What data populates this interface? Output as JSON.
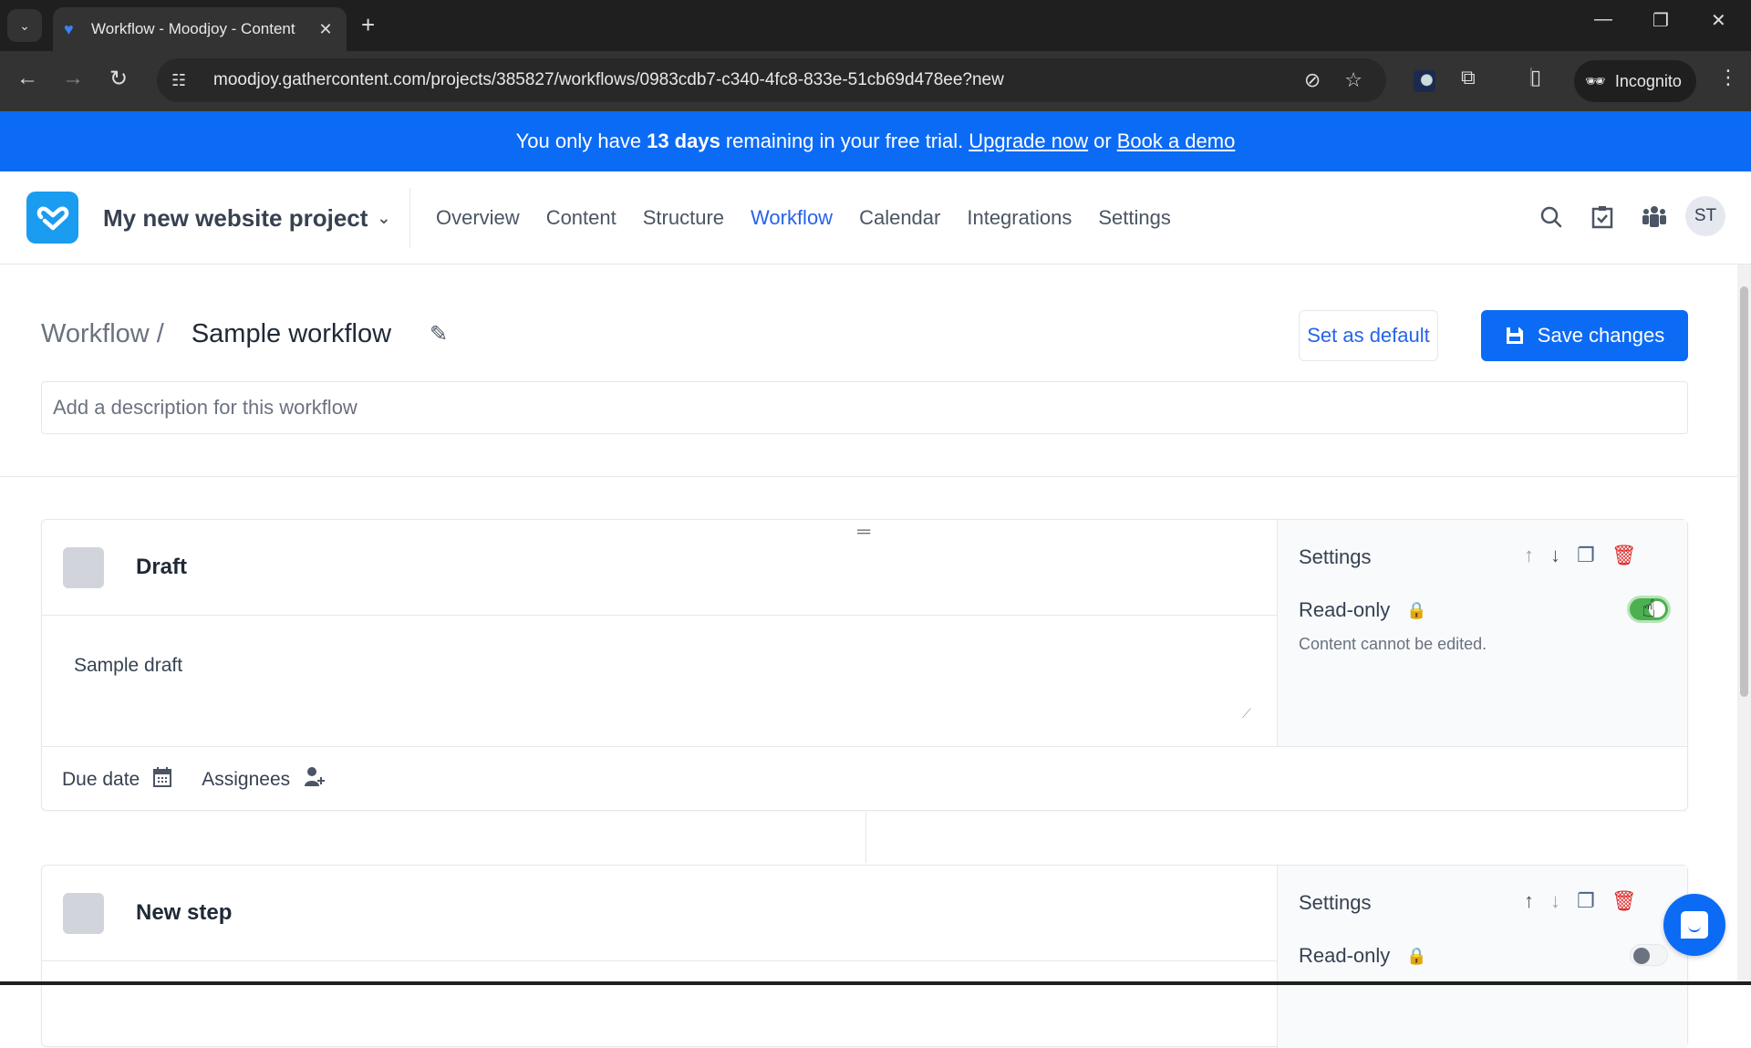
{
  "browser": {
    "tab_title": "Workflow - Moodjoy - Content",
    "url": "moodjoy.gathercontent.com/projects/385827/workflows/0983cdb7-c340-4fc8-833e-51cb69d478ee?new",
    "incognito_label": "Incognito",
    "icons": {
      "tab_search": "chevron-down-icon",
      "new_tab": "plus-icon",
      "back": "back-arrow-icon",
      "forward": "forward-arrow-icon",
      "reload": "reload-icon",
      "site_info": "tune-icon",
      "tracking": "eye-off-icon",
      "bookmark": "star-icon",
      "extensions": "puzzle-icon",
      "sidepanel": "side-panel-icon",
      "menu": "kebab-menu-icon"
    }
  },
  "banner": {
    "prefix": "You only have",
    "days": "13 days",
    "middle": "remaining in your free trial.",
    "upgrade_link": "Upgrade now",
    "or": "or",
    "demo_link": "Book a demo"
  },
  "header": {
    "project_name": "My new website project",
    "nav": [
      {
        "label": "Overview",
        "active": false
      },
      {
        "label": "Content",
        "active": false
      },
      {
        "label": "Structure",
        "active": false
      },
      {
        "label": "Workflow",
        "active": true
      },
      {
        "label": "Calendar",
        "active": false
      },
      {
        "label": "Integrations",
        "active": false
      },
      {
        "label": "Settings",
        "active": false
      }
    ],
    "avatar_initials": "ST"
  },
  "page": {
    "breadcrumb_parent": "Workflow /",
    "title": "Sample workflow",
    "set_default_label": "Set as default",
    "save_label": "Save changes",
    "description_placeholder": "Add a description for this workflow"
  },
  "steps": [
    {
      "name": "Draft",
      "description": "Sample draft",
      "due_date_label": "Due date",
      "assignees_label": "Assignees",
      "settings_title": "Settings",
      "read_only_label": "Read-only",
      "read_only": true,
      "read_only_hint": "Content cannot be edited."
    },
    {
      "name": "New step",
      "settings_title": "Settings",
      "read_only_label": "Read-only",
      "read_only": false
    }
  ],
  "colors": {
    "accent": "#0c6bf5",
    "link": "#2563eb",
    "toggle_on": "#4caf50",
    "delete": "#dc2626",
    "step_swatch": "#d1d5db"
  }
}
